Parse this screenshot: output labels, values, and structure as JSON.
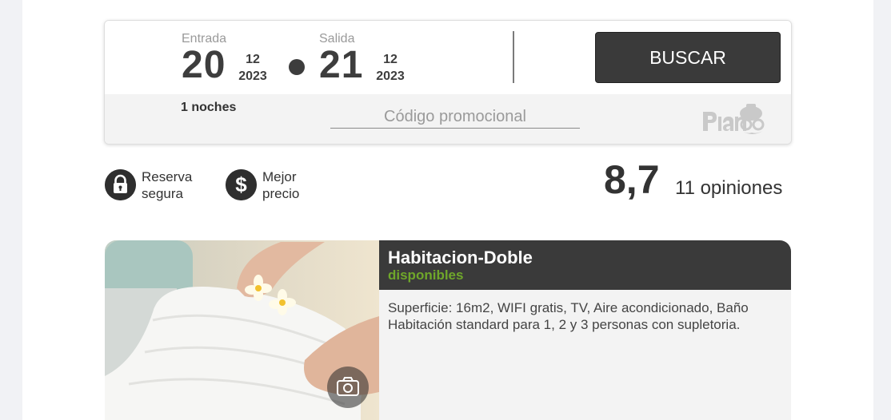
{
  "booking": {
    "checkin": {
      "label": "Entrada",
      "day": "20",
      "month": "12",
      "year": "2023"
    },
    "checkout": {
      "label": "Salida",
      "day": "21",
      "month": "12",
      "year": "2023"
    },
    "search_label": "BUSCAR",
    "nights": "1 noches",
    "promo_placeholder": "Código promocional",
    "promo_value": ""
  },
  "badges": [
    {
      "icon": "lock-icon",
      "line1": "Reserva",
      "line2": "segura"
    },
    {
      "icon": "dollar-icon",
      "line1": "Mejor",
      "line2": "precio"
    }
  ],
  "rating": {
    "score": "8,7",
    "reviews": "11 opiniones"
  },
  "room": {
    "title": "Habitacion-Doble",
    "availability": "disponibles",
    "description_line1": "Superficie: 16m2,  WIFI gratis, TV, Aire acondicionado, Baño",
    "description_line2": "Habitación standard para 1, 2 y 3 personas con supletoria.",
    "photo_icon": "camera-icon"
  },
  "colors": {
    "dark": "#3a3a3a",
    "accent_green": "#6fa72a",
    "panel_gray": "#f3f3f3",
    "background": "#f1f2f5"
  }
}
